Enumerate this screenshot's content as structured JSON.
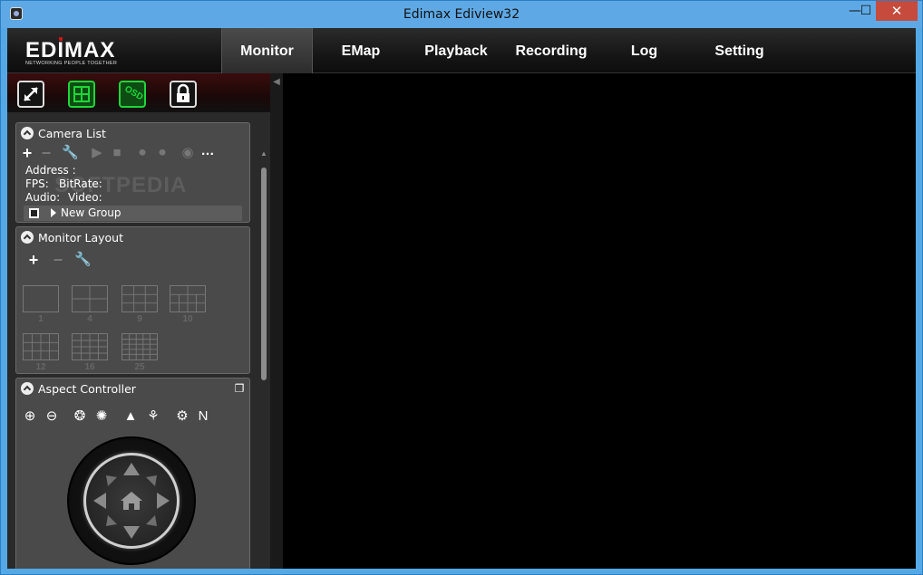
{
  "window": {
    "title": "Edimax Ediview32",
    "min": "—",
    "max": "☐",
    "close": "✕"
  },
  "logo": {
    "text": "EDIMAX",
    "tagline": "NETWORKING PEOPLE TOGETHER"
  },
  "nav": {
    "tabs": [
      {
        "label": "Monitor",
        "active": true
      },
      {
        "label": "EMap"
      },
      {
        "label": "Playback"
      },
      {
        "label": "Recording"
      },
      {
        "label": "Log"
      },
      {
        "label": "Setting"
      }
    ]
  },
  "toolbar": {
    "buttons": [
      "fullscreen-icon",
      "grid-icon",
      "osd-icon",
      "unlock-icon"
    ]
  },
  "camera_list": {
    "title": "Camera List",
    "address_label": "Address :",
    "fps_label": "FPS:",
    "bitrate_label": "BitRate:",
    "audio_label": "Audio:",
    "video_label": "Video:",
    "group": "New Group",
    "watermark": "SOFTPEDIA"
  },
  "monitor_layout": {
    "title": "Monitor Layout",
    "layouts": [
      "1",
      "4",
      "9",
      "10",
      "12",
      "16",
      "25"
    ]
  },
  "aspect_controller": {
    "title": "Aspect Controller"
  },
  "colors": {
    "accent_green": "#1fd63a",
    "titlebar": "#5ea9e5",
    "close": "#c74b3c"
  }
}
